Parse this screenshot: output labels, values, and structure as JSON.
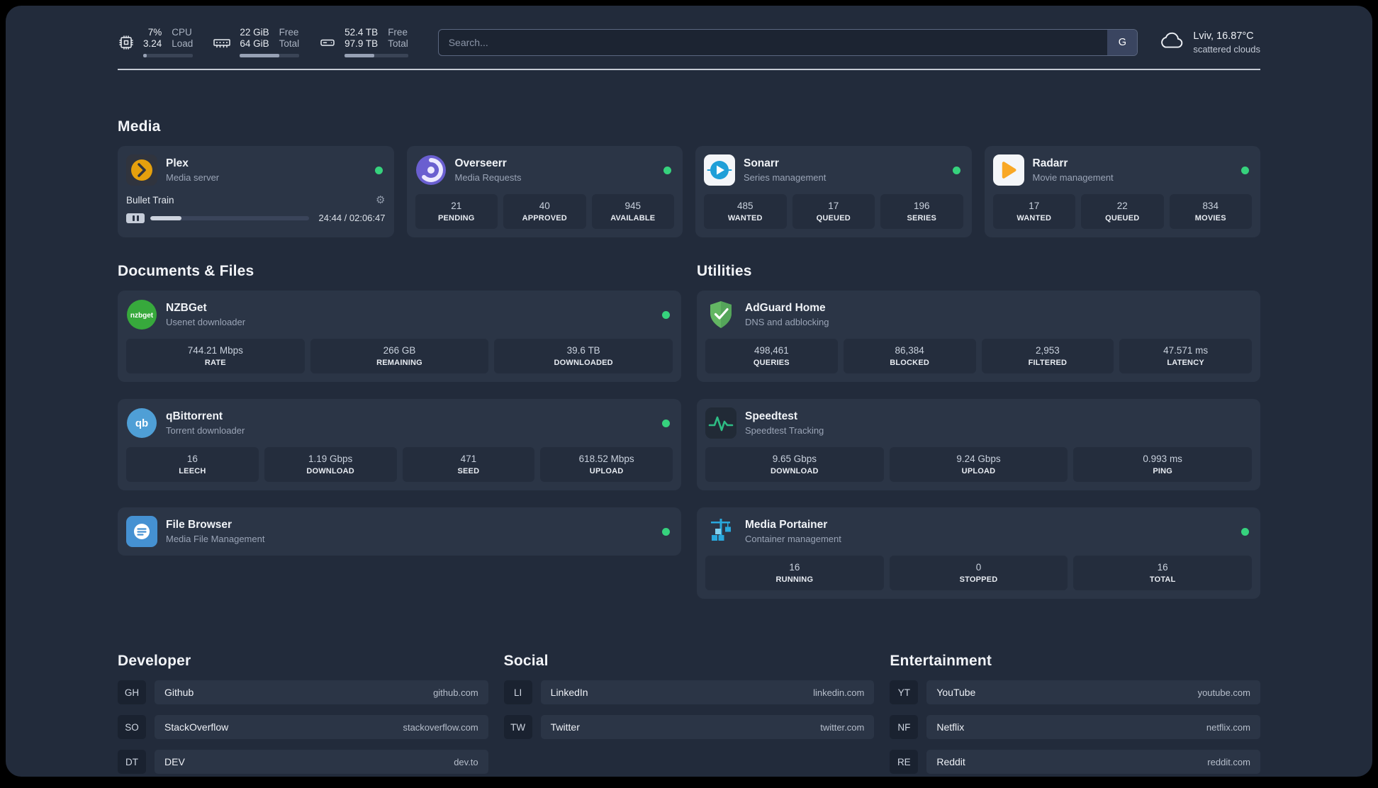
{
  "topbar": {
    "cpu": {
      "pct": "7%",
      "load": "3.24",
      "label_top": "CPU",
      "label_bottom": "Load",
      "bar_style": "width:7%"
    },
    "ram": {
      "free": "22 GiB",
      "total": "64 GiB",
      "label_top": "Free",
      "label_bottom": "Total",
      "bar_style": "width:66%"
    },
    "disk": {
      "free": "52.4 TB",
      "total": "97.9 TB",
      "label_top": "Free",
      "label_bottom": "Total",
      "bar_style": "width:47%"
    },
    "search": {
      "placeholder": "Search...",
      "button_label": "G"
    },
    "weather": {
      "location": "Lviv, 16.87°C",
      "condition": "scattered clouds"
    }
  },
  "media": {
    "title": "Media",
    "plex": {
      "title": "Plex",
      "subtitle": "Media server",
      "now_playing": "Bullet Train",
      "time": "24:44 / 02:06:47",
      "progress_style": "width:19.5%"
    },
    "overseerr": {
      "title": "Overseerr",
      "subtitle": "Media Requests",
      "stats": [
        {
          "v": "21",
          "l": "PENDING"
        },
        {
          "v": "40",
          "l": "APPROVED"
        },
        {
          "v": "945",
          "l": "AVAILABLE"
        }
      ]
    },
    "sonarr": {
      "title": "Sonarr",
      "subtitle": "Series management",
      "stats": [
        {
          "v": "485",
          "l": "WANTED"
        },
        {
          "v": "17",
          "l": "QUEUED"
        },
        {
          "v": "196",
          "l": "SERIES"
        }
      ]
    },
    "radarr": {
      "title": "Radarr",
      "subtitle": "Movie management",
      "stats": [
        {
          "v": "17",
          "l": "WANTED"
        },
        {
          "v": "22",
          "l": "QUEUED"
        },
        {
          "v": "834",
          "l": "MOVIES"
        }
      ]
    }
  },
  "documents": {
    "title": "Documents & Files",
    "nzbget": {
      "title": "NZBGet",
      "subtitle": "Usenet downloader",
      "stats": [
        {
          "v": "744.21 Mbps",
          "l": "RATE"
        },
        {
          "v": "266 GB",
          "l": "REMAINING"
        },
        {
          "v": "39.6 TB",
          "l": "DOWNLOADED"
        }
      ]
    },
    "qbittorrent": {
      "title": "qBittorrent",
      "subtitle": "Torrent downloader",
      "stats": [
        {
          "v": "16",
          "l": "LEECH"
        },
        {
          "v": "1.19 Gbps",
          "l": "DOWNLOAD"
        },
        {
          "v": "471",
          "l": "SEED"
        },
        {
          "v": "618.52 Mbps",
          "l": "UPLOAD"
        }
      ]
    },
    "filebrowser": {
      "title": "File Browser",
      "subtitle": "Media File Management"
    }
  },
  "utilities": {
    "title": "Utilities",
    "adguard": {
      "title": "AdGuard Home",
      "subtitle": "DNS and adblocking",
      "stats": [
        {
          "v": "498,461",
          "l": "QUERIES"
        },
        {
          "v": "86,384",
          "l": "BLOCKED"
        },
        {
          "v": "2,953",
          "l": "FILTERED"
        },
        {
          "v": "47.571 ms",
          "l": "LATENCY"
        }
      ]
    },
    "speedtest": {
      "title": "Speedtest",
      "subtitle": "Speedtest Tracking",
      "stats": [
        {
          "v": "9.65 Gbps",
          "l": "DOWNLOAD"
        },
        {
          "v": "9.24 Gbps",
          "l": "UPLOAD"
        },
        {
          "v": "0.993 ms",
          "l": "PING"
        }
      ]
    },
    "portainer": {
      "title": "Media Portainer",
      "subtitle": "Container management",
      "stats": [
        {
          "v": "16",
          "l": "RUNNING"
        },
        {
          "v": "0",
          "l": "STOPPED"
        },
        {
          "v": "16",
          "l": "TOTAL"
        }
      ]
    }
  },
  "link_sections": {
    "developer": {
      "title": "Developer",
      "links": [
        {
          "tag": "GH",
          "name": "Github",
          "url": "github.com"
        },
        {
          "tag": "SO",
          "name": "StackOverflow",
          "url": "stackoverflow.com"
        },
        {
          "tag": "DT",
          "name": "DEV",
          "url": "dev.to"
        }
      ]
    },
    "social": {
      "title": "Social",
      "links": [
        {
          "tag": "LI",
          "name": "LinkedIn",
          "url": "linkedin.com"
        },
        {
          "tag": "TW",
          "name": "Twitter",
          "url": "twitter.com"
        }
      ]
    },
    "entertainment": {
      "title": "Entertainment",
      "links": [
        {
          "tag": "YT",
          "name": "YouTube",
          "url": "youtube.com"
        },
        {
          "tag": "NF",
          "name": "Netflix",
          "url": "netflix.com"
        },
        {
          "tag": "RE",
          "name": "Reddit",
          "url": "reddit.com"
        }
      ]
    }
  },
  "colors": {
    "status_green": "#36d27d",
    "plex_amber": "#e5a00d"
  }
}
